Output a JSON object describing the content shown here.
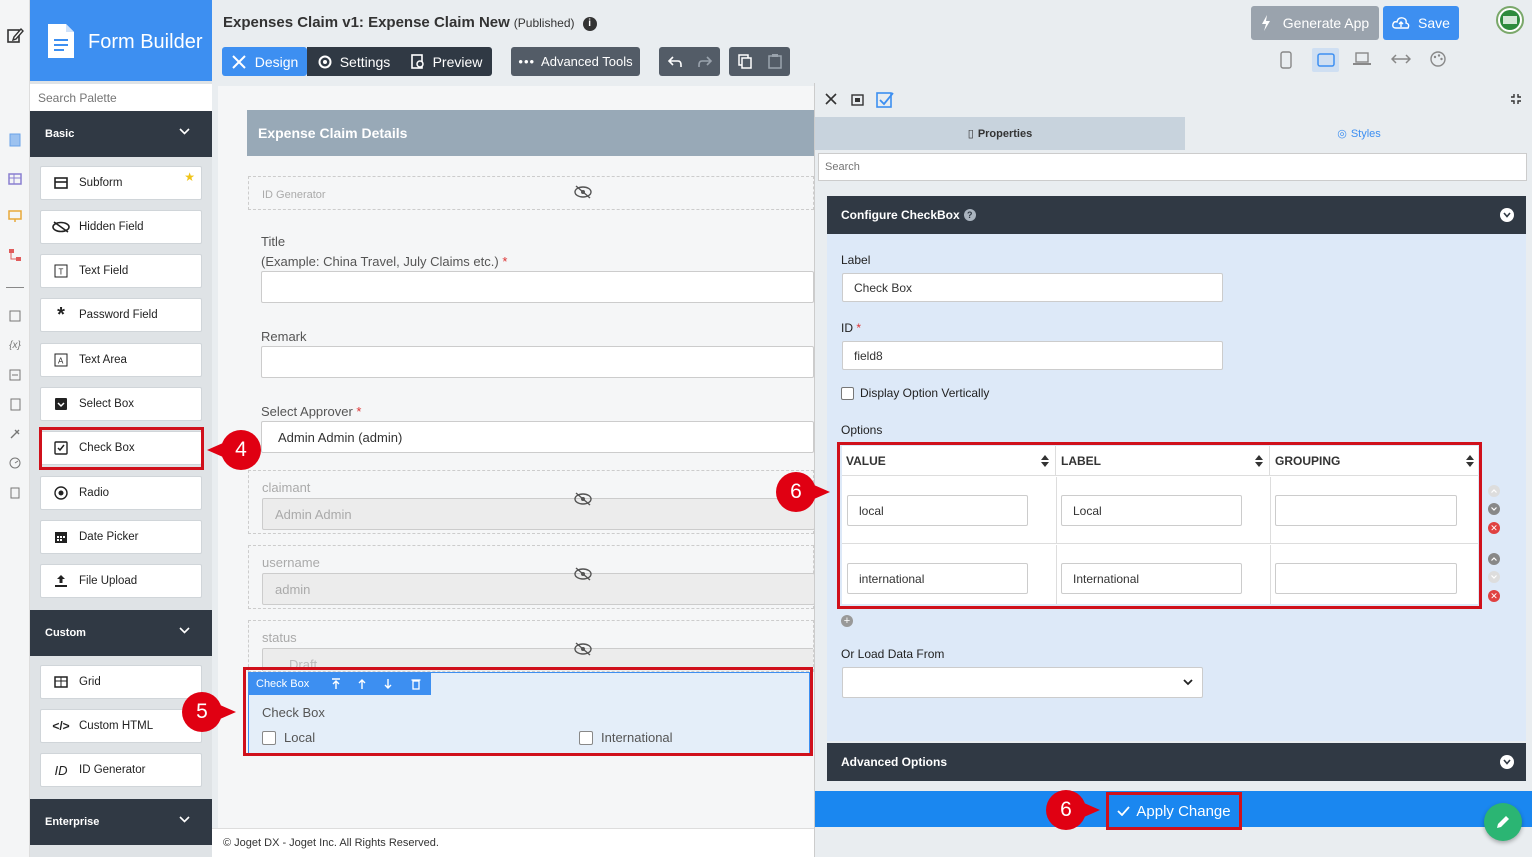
{
  "brand": {
    "title": "Form Builder"
  },
  "palette": {
    "search_placeholder": "Search Palette",
    "sections": {
      "basic": "Basic",
      "custom": "Custom",
      "enterprise": "Enterprise"
    },
    "basic_items": [
      "Subform",
      "Hidden Field",
      "Text Field",
      "Password Field",
      "Text Area",
      "Select Box",
      "Check Box",
      "Radio",
      "Date Picker",
      "File Upload"
    ],
    "custom_items": [
      "Grid",
      "Custom HTML",
      "ID Generator"
    ]
  },
  "header": {
    "title": "Expenses Claim v1: Expense Claim New",
    "status": "(Published)",
    "design": "Design",
    "settings": "Settings",
    "preview": "Preview",
    "advanced_tools": "Advanced Tools",
    "generate_app": "Generate App",
    "save": "Save"
  },
  "canvas": {
    "section_title": "Expense Claim Details",
    "id_generator_label": "ID Generator",
    "title_label": "Title",
    "title_hint": "(Example: China Travel, July Claims etc.)",
    "required_mark": "*",
    "remark_label": "Remark",
    "approver_label": "Select Approver",
    "approver_value": "Admin Admin (admin)",
    "claimant_label": "claimant",
    "claimant_value": "Admin Admin",
    "username_label": "username",
    "username_value": "admin",
    "status_label": "status",
    "status_value": "Draft",
    "checkbox_toolbar_label": "Check Box",
    "checkbox_label": "Check Box",
    "checkbox_options": [
      "Local",
      "International"
    ]
  },
  "footer": {
    "copyright": "© Joget DX - Joget Inc. All Rights Reserved."
  },
  "panel": {
    "tab_properties": "Properties",
    "tab_styles": "Styles",
    "search_placeholder": "Search",
    "configure_title": "Configure CheckBox",
    "label_label": "Label",
    "label_value": "Check Box",
    "id_label": "ID",
    "id_required": "*",
    "id_value": "field8",
    "display_vertical": "Display Option Vertically",
    "options_label": "Options",
    "columns": [
      "VALUE",
      "LABEL",
      "GROUPING"
    ],
    "options": [
      {
        "value": "local",
        "label": "Local",
        "grouping": ""
      },
      {
        "value": "international",
        "label": "International",
        "grouping": ""
      }
    ],
    "load_data_label": "Or Load Data From",
    "advanced_options": "Advanced Options",
    "apply_change": "Apply Change"
  },
  "callouts": {
    "c4": "4",
    "c5": "5",
    "c6a": "6",
    "c6b": "6"
  },
  "colors": {
    "brand_blue": "#3d8ff1",
    "dark_header": "#303944",
    "callout_red": "#e00012",
    "apply_blue": "#1a87f0"
  }
}
